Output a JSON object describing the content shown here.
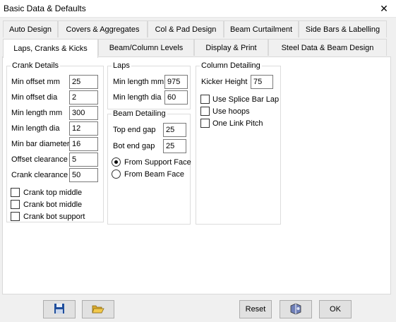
{
  "window": {
    "title": "Basic Data & Defaults"
  },
  "tabs_row1": [
    "Auto Design",
    "Covers & Aggregates",
    "Col & Pad Design",
    "Beam Curtailment",
    "Side Bars & Labelling"
  ],
  "tabs_row2": [
    "Laps, Cranks & Kicks",
    "Beam/Column Levels",
    "Display & Print",
    "Steel Data & Beam Design"
  ],
  "active_tab": "Laps, Cranks & Kicks",
  "crank": {
    "title": "Crank Details",
    "min_offset_mm": {
      "label": "Min offset mm",
      "value": "25"
    },
    "min_offset_dia": {
      "label": "Min offset dia",
      "value": "2"
    },
    "min_length_mm": {
      "label": "Min length mm",
      "value": "300"
    },
    "min_length_dia": {
      "label": "Min length dia",
      "value": "12"
    },
    "min_bar_diameter": {
      "label": "Min bar diameter",
      "value": "16"
    },
    "offset_clearance": {
      "label": "Offset clearance",
      "value": "5"
    },
    "crank_clearance": {
      "label": "Crank clearance",
      "value": "50"
    },
    "checks": [
      {
        "label": "Crank top middle",
        "checked": false
      },
      {
        "label": "Crank bot middle",
        "checked": false
      },
      {
        "label": "Crank bot support",
        "checked": false
      }
    ]
  },
  "laps": {
    "title": "Laps",
    "min_length_mm": {
      "label": "Min length mm",
      "value": "975"
    },
    "min_length_dia": {
      "label": "Min length dia",
      "value": "60"
    }
  },
  "beam_detailing": {
    "title": "Beam Detailing",
    "top_end_gap": {
      "label": "Top end gap",
      "value": "25"
    },
    "bot_end_gap": {
      "label": "Bot end gap",
      "value": "25"
    },
    "radios": [
      {
        "label": "From Support Face",
        "checked": true
      },
      {
        "label": "From Beam Face",
        "checked": false
      }
    ]
  },
  "column_detailing": {
    "title": "Column Detailing",
    "kicker_height": {
      "label": "Kicker Height",
      "value": "75"
    },
    "checks": [
      {
        "label": "Use Splice Bar Lap",
        "checked": false
      },
      {
        "label": "Use hoops",
        "checked": false
      },
      {
        "label": "One Link Pitch",
        "checked": false
      }
    ]
  },
  "footer": {
    "reset_label": "Reset",
    "ok_label": "OK"
  },
  "icons": {
    "save": "save-disk-icon",
    "open": "open-folder-icon",
    "help": "help-book-icon"
  },
  "colors": {
    "panel": "#ffffff",
    "background": "#f0f0f0",
    "button": "#e1e1e1",
    "save_blue": "#1f4e9c",
    "folder_yellow": "#f2c94c"
  }
}
